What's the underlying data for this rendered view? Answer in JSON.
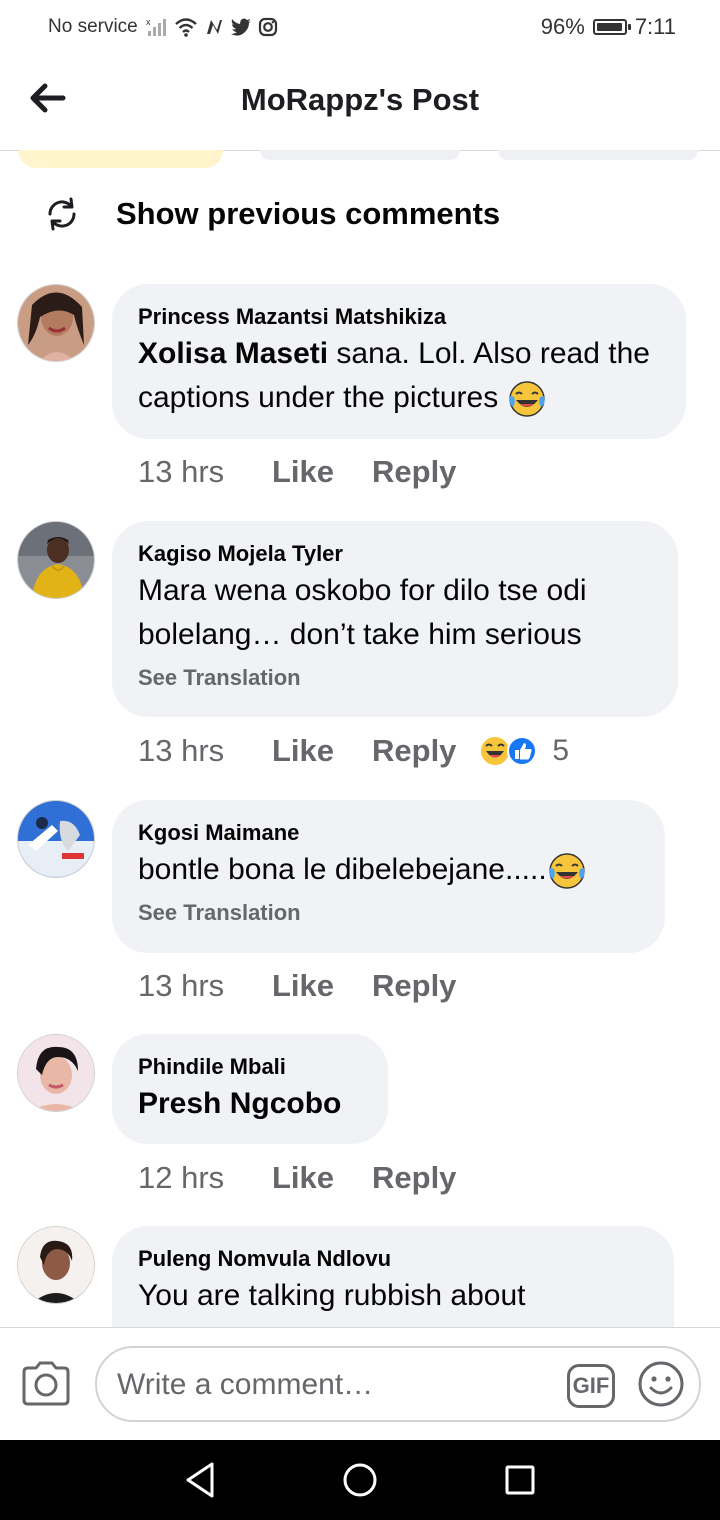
{
  "status_bar": {
    "carrier": "No service",
    "battery": "96%",
    "battery_level": 0.96,
    "time": "7:11",
    "icons": [
      "no-signal-icon",
      "wifi-icon",
      "n-app-icon",
      "twitter-icon",
      "instagram-icon"
    ]
  },
  "header": {
    "back_icon": "arrow-left-icon",
    "title": "MoRappz's Post"
  },
  "show_previous": {
    "icon": "refresh-icon",
    "label": "Show previous comments"
  },
  "comments": [
    {
      "name": "Princess Mazantsi Matshikiza",
      "mention": "Xolisa Maseti",
      "text": " sana. Lol. Also read the captions under the pictures ",
      "emoji": "laughing-tears-emoji",
      "time": "13 hrs",
      "like": "Like",
      "reply": "Reply"
    },
    {
      "name": "Kagiso Mojela Tyler",
      "text": "Mara wena oskobo for dilo tse odi bolelang… don’t take him serious",
      "see_translation": "See Translation",
      "time": "13 hrs",
      "like": "Like",
      "reply": "Reply",
      "reactions": [
        "laughing-emoji",
        "like-reaction-icon"
      ],
      "reaction_count": "5"
    },
    {
      "name": "Kgosi Maimane",
      "text": "bontle bona le dibelebejane.....",
      "emoji": "laughing-tears-emoji",
      "see_translation": "See Translation",
      "time": "13 hrs",
      "like": "Like",
      "reply": "Reply"
    },
    {
      "name": "Phindile Mbali",
      "mention": "Presh Ngcobo",
      "time": "12 hrs",
      "like": "Like",
      "reply": "Reply"
    },
    {
      "name": "Puleng Nomvula Ndlovu",
      "text": "You are talking rubbish about"
    }
  ],
  "composer": {
    "camera_icon": "camera-icon",
    "placeholder": "Write a comment…",
    "gif_label": "GIF",
    "emoji_icon": "smiley-icon"
  },
  "nav_bar": {
    "icons": [
      "back-triangle-icon",
      "home-circle-icon",
      "recents-square-icon"
    ]
  },
  "colors": {
    "bubble": "#f0f2f5",
    "meta_text": "#65676b",
    "like_blue": "#1877f2",
    "emoji_yellow": "#f7c53c"
  }
}
